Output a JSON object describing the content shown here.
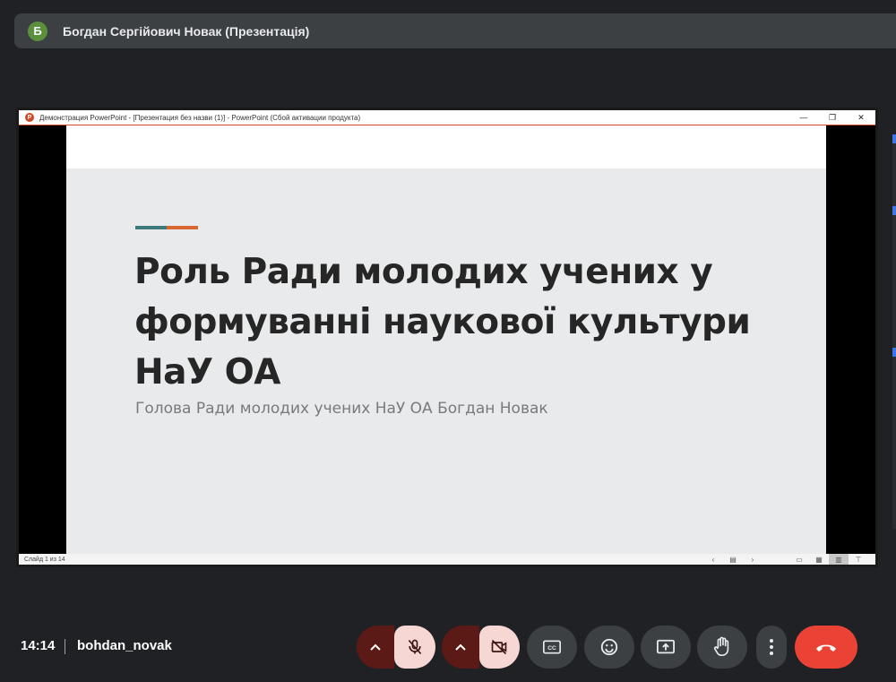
{
  "presenter": {
    "avatar_letter": "Б",
    "name": "Богдан Сергійович Новак (Презентація)"
  },
  "ppt_window": {
    "title": "Демонстрация PowerPoint - [Презентация без назви (1)] - PowerPoint (Сбой активации продукта)",
    "controls": {
      "minimize": "—",
      "restore": "❐",
      "close": "✕"
    },
    "status": {
      "slide_counter": "Слайд 1 из 14"
    }
  },
  "slide": {
    "title_lines": [
      "Роль Ради молодих учених у",
      "формуванні наукової культури",
      "НаУ ОА"
    ],
    "subtitle": "Голова Ради молодих учених НаУ ОА Богдан Новак"
  },
  "bottom_bar": {
    "time": "14:14",
    "meeting": "bohdan_novak"
  },
  "colors": {
    "end_call": "#ea4335",
    "muted_bg": "#f6d7d3",
    "accent_teal": "#3c7a7c",
    "accent_orange": "#d8682f"
  },
  "icons": {
    "mic": "mic-off-icon",
    "camera": "videocam-off-icon",
    "captions": "closed-caption-icon",
    "emoji": "emoji-icon",
    "present": "present-screen-icon",
    "hand": "raise-hand-icon",
    "more": "more-vert-icon",
    "end": "call-end-icon"
  }
}
